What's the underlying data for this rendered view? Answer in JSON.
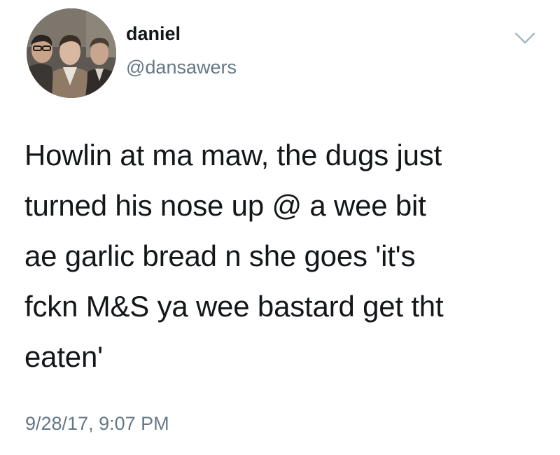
{
  "user": {
    "display_name": "daniel",
    "handle": "@dansawers"
  },
  "tweet": {
    "text": "Howlin at ma maw, the dugs just\nturned his nose up @ a wee bit\nae garlic bread n she goes 'it's\nfckn M&S ya wee bastard get tht\neaten'",
    "timestamp": "9/28/17, 9:07 PM"
  },
  "icons": {
    "more": "chevron-down-icon"
  },
  "colors": {
    "text": "#14171a",
    "secondary_text": "#657786",
    "caret": "#aab8c2",
    "background": "#ffffff"
  }
}
